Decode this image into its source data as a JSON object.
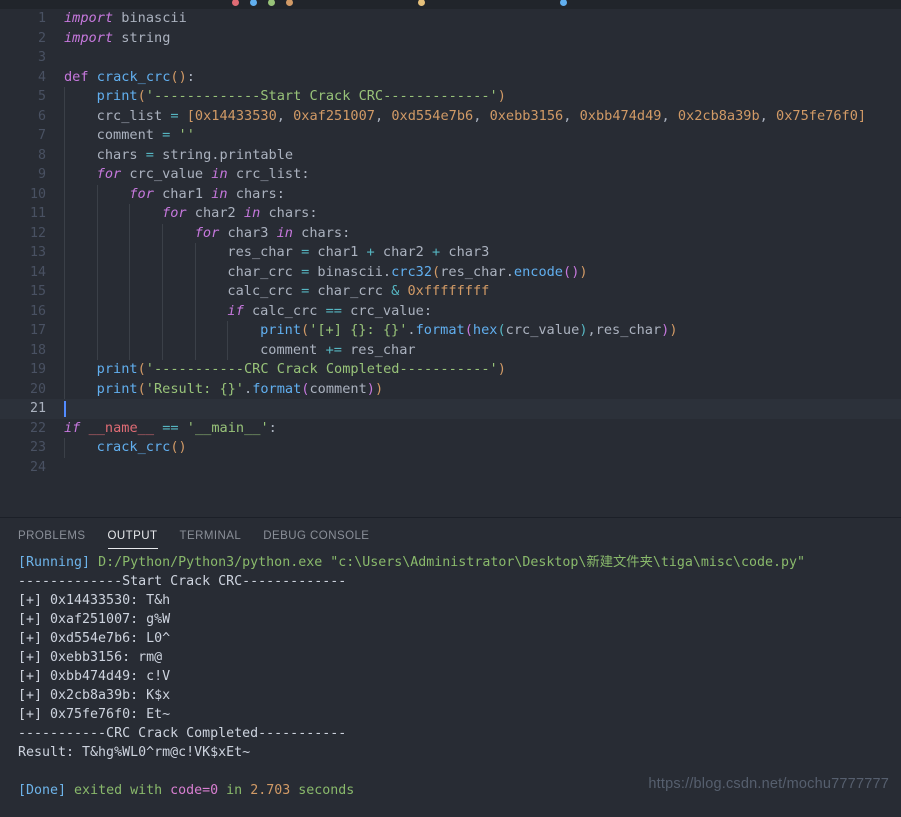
{
  "window": {
    "theme_name": "One Dark Pro",
    "editor_bg": "#282c34",
    "active_line_bg": "#2c313a",
    "panel_bg": "#282c34"
  },
  "editor": {
    "language": "python",
    "active_line": 21,
    "total_lines": 24,
    "lines": [
      {
        "n": "1",
        "indent": 0,
        "tokens": [
          {
            "t": "import",
            "c": "kw"
          },
          {
            "t": " binascii",
            "c": "plain"
          }
        ]
      },
      {
        "n": "2",
        "indent": 0,
        "tokens": [
          {
            "t": "import",
            "c": "kw"
          },
          {
            "t": " string",
            "c": "plain"
          }
        ]
      },
      {
        "n": "3",
        "indent": 0,
        "tokens": []
      },
      {
        "n": "4",
        "indent": 0,
        "tokens": [
          {
            "t": "def",
            "c": "kw2"
          },
          {
            "t": " ",
            "c": "plain"
          },
          {
            "t": "crack_crc",
            "c": "defn"
          },
          {
            "t": "()",
            "c": "par"
          },
          {
            "t": ":",
            "c": "punc"
          }
        ]
      },
      {
        "n": "5",
        "indent": 1,
        "tokens": [
          {
            "t": "print",
            "c": "fn"
          },
          {
            "t": "(",
            "c": "par"
          },
          {
            "t": "'-------------Start Crack CRC-------------'",
            "c": "str"
          },
          {
            "t": ")",
            "c": "par"
          }
        ]
      },
      {
        "n": "6",
        "indent": 1,
        "tokens": [
          {
            "t": "crc_list ",
            "c": "plain"
          },
          {
            "t": "=",
            "c": "op"
          },
          {
            "t": " ",
            "c": "plain"
          },
          {
            "t": "[",
            "c": "par"
          },
          {
            "t": "0x14433530",
            "c": "num"
          },
          {
            "t": ", ",
            "c": "plain"
          },
          {
            "t": "0xaf251007",
            "c": "num"
          },
          {
            "t": ", ",
            "c": "plain"
          },
          {
            "t": "0xd554e7b6",
            "c": "num"
          },
          {
            "t": ", ",
            "c": "plain"
          },
          {
            "t": "0xebb3156",
            "c": "num"
          },
          {
            "t": ", ",
            "c": "plain"
          },
          {
            "t": "0xbb474d49",
            "c": "num"
          },
          {
            "t": ", ",
            "c": "plain"
          },
          {
            "t": "0x2cb8a39b",
            "c": "num"
          },
          {
            "t": ", ",
            "c": "plain"
          },
          {
            "t": "0x75fe76f0",
            "c": "num"
          },
          {
            "t": "]",
            "c": "par"
          }
        ]
      },
      {
        "n": "7",
        "indent": 1,
        "tokens": [
          {
            "t": "comment ",
            "c": "plain"
          },
          {
            "t": "=",
            "c": "op"
          },
          {
            "t": " ",
            "c": "plain"
          },
          {
            "t": "''",
            "c": "str"
          }
        ]
      },
      {
        "n": "8",
        "indent": 1,
        "tokens": [
          {
            "t": "chars ",
            "c": "plain"
          },
          {
            "t": "=",
            "c": "op"
          },
          {
            "t": " string",
            "c": "plain"
          },
          {
            "t": ".",
            "c": "punc"
          },
          {
            "t": "printable",
            "c": "plain"
          }
        ]
      },
      {
        "n": "9",
        "indent": 1,
        "tokens": [
          {
            "t": "for",
            "c": "kw"
          },
          {
            "t": " crc_value ",
            "c": "plain"
          },
          {
            "t": "in",
            "c": "kw"
          },
          {
            "t": " crc_list",
            "c": "plain"
          },
          {
            "t": ":",
            "c": "punc"
          }
        ]
      },
      {
        "n": "10",
        "indent": 2,
        "tokens": [
          {
            "t": "for",
            "c": "kw"
          },
          {
            "t": " char1 ",
            "c": "plain"
          },
          {
            "t": "in",
            "c": "kw"
          },
          {
            "t": " chars",
            "c": "plain"
          },
          {
            "t": ":",
            "c": "punc"
          }
        ]
      },
      {
        "n": "11",
        "indent": 3,
        "tokens": [
          {
            "t": "for",
            "c": "kw"
          },
          {
            "t": " char2 ",
            "c": "plain"
          },
          {
            "t": "in",
            "c": "kw"
          },
          {
            "t": " chars",
            "c": "plain"
          },
          {
            "t": ":",
            "c": "punc"
          }
        ]
      },
      {
        "n": "12",
        "indent": 4,
        "tokens": [
          {
            "t": "for",
            "c": "kw"
          },
          {
            "t": " char3 ",
            "c": "plain"
          },
          {
            "t": "in",
            "c": "kw"
          },
          {
            "t": " chars",
            "c": "plain"
          },
          {
            "t": ":",
            "c": "punc"
          }
        ]
      },
      {
        "n": "13",
        "indent": 5,
        "tokens": [
          {
            "t": "res_char ",
            "c": "plain"
          },
          {
            "t": "=",
            "c": "op"
          },
          {
            "t": " char1 ",
            "c": "plain"
          },
          {
            "t": "+",
            "c": "op"
          },
          {
            "t": " char2 ",
            "c": "plain"
          },
          {
            "t": "+",
            "c": "op"
          },
          {
            "t": " char3",
            "c": "plain"
          }
        ]
      },
      {
        "n": "14",
        "indent": 5,
        "tokens": [
          {
            "t": "char_crc ",
            "c": "plain"
          },
          {
            "t": "=",
            "c": "op"
          },
          {
            "t": " binascii",
            "c": "plain"
          },
          {
            "t": ".",
            "c": "punc"
          },
          {
            "t": "crc32",
            "c": "fn"
          },
          {
            "t": "(",
            "c": "par"
          },
          {
            "t": "res_char",
            "c": "plain"
          },
          {
            "t": ".",
            "c": "punc"
          },
          {
            "t": "encode",
            "c": "fn"
          },
          {
            "t": "(",
            "c": "par2"
          },
          {
            "t": ")",
            "c": "par2"
          },
          {
            "t": ")",
            "c": "par"
          }
        ]
      },
      {
        "n": "15",
        "indent": 5,
        "tokens": [
          {
            "t": "calc_crc ",
            "c": "plain"
          },
          {
            "t": "=",
            "c": "op"
          },
          {
            "t": " char_crc ",
            "c": "plain"
          },
          {
            "t": "&",
            "c": "op"
          },
          {
            "t": " ",
            "c": "plain"
          },
          {
            "t": "0xffffffff",
            "c": "num"
          }
        ]
      },
      {
        "n": "16",
        "indent": 5,
        "tokens": [
          {
            "t": "if",
            "c": "kw"
          },
          {
            "t": " calc_crc ",
            "c": "plain"
          },
          {
            "t": "==",
            "c": "op"
          },
          {
            "t": " crc_value",
            "c": "plain"
          },
          {
            "t": ":",
            "c": "punc"
          }
        ]
      },
      {
        "n": "17",
        "indent": 6,
        "tokens": [
          {
            "t": "print",
            "c": "fn"
          },
          {
            "t": "(",
            "c": "par"
          },
          {
            "t": "'[+] {}: {}'",
            "c": "str"
          },
          {
            "t": ".",
            "c": "punc"
          },
          {
            "t": "format",
            "c": "fn"
          },
          {
            "t": "(",
            "c": "par2"
          },
          {
            "t": "hex",
            "c": "fn"
          },
          {
            "t": "(",
            "c": "par3"
          },
          {
            "t": "crc_value",
            "c": "plain"
          },
          {
            "t": ")",
            "c": "par3"
          },
          {
            "t": ",res_char",
            "c": "plain"
          },
          {
            "t": ")",
            "c": "par2"
          },
          {
            "t": ")",
            "c": "par"
          }
        ]
      },
      {
        "n": "18",
        "indent": 6,
        "tokens": [
          {
            "t": "comment ",
            "c": "plain"
          },
          {
            "t": "+=",
            "c": "op"
          },
          {
            "t": " res_char",
            "c": "plain"
          }
        ]
      },
      {
        "n": "19",
        "indent": 1,
        "tokens": [
          {
            "t": "print",
            "c": "fn"
          },
          {
            "t": "(",
            "c": "par"
          },
          {
            "t": "'-----------CRC Crack Completed-----------'",
            "c": "str"
          },
          {
            "t": ")",
            "c": "par"
          }
        ]
      },
      {
        "n": "20",
        "indent": 1,
        "tokens": [
          {
            "t": "print",
            "c": "fn"
          },
          {
            "t": "(",
            "c": "par"
          },
          {
            "t": "'Result: {}'",
            "c": "str"
          },
          {
            "t": ".",
            "c": "punc"
          },
          {
            "t": "format",
            "c": "fn"
          },
          {
            "t": "(",
            "c": "par2"
          },
          {
            "t": "comment",
            "c": "plain"
          },
          {
            "t": ")",
            "c": "par2"
          },
          {
            "t": ")",
            "c": "par"
          }
        ]
      },
      {
        "n": "21",
        "indent": 0,
        "tokens": []
      },
      {
        "n": "22",
        "indent": 0,
        "tokens": [
          {
            "t": "if",
            "c": "kw"
          },
          {
            "t": " ",
            "c": "plain"
          },
          {
            "t": "__name__",
            "c": "var"
          },
          {
            "t": " ",
            "c": "plain"
          },
          {
            "t": "==",
            "c": "op"
          },
          {
            "t": " ",
            "c": "plain"
          },
          {
            "t": "'__main__'",
            "c": "str"
          },
          {
            "t": ":",
            "c": "punc"
          }
        ]
      },
      {
        "n": "23",
        "indent": 1,
        "tokens": [
          {
            "t": "crack_crc",
            "c": "fn"
          },
          {
            "t": "()",
            "c": "par"
          }
        ]
      },
      {
        "n": "24",
        "indent": 0,
        "tokens": []
      }
    ]
  },
  "panel": {
    "tabs": [
      {
        "label": "PROBLEMS",
        "active": false
      },
      {
        "label": "OUTPUT",
        "active": true
      },
      {
        "label": "TERMINAL",
        "active": false
      },
      {
        "label": "DEBUG CONSOLE",
        "active": false
      }
    ],
    "output_lines": [
      {
        "segments": [
          {
            "t": "[Running]",
            "c": "o-run"
          },
          {
            "t": " D:/Python/Python3/python.exe \"c:\\Users\\Administrator\\Desktop\\新建文件夹\\tiga\\misc\\code.py\"",
            "c": "o-path"
          }
        ]
      },
      {
        "segments": [
          {
            "t": "-------------Start Crack CRC-------------",
            "c": "o-grey"
          }
        ]
      },
      {
        "segments": [
          {
            "t": "[+] 0x14433530: T&h",
            "c": "o-grey"
          }
        ]
      },
      {
        "segments": [
          {
            "t": "[+] 0xaf251007: g%W",
            "c": "o-grey"
          }
        ]
      },
      {
        "segments": [
          {
            "t": "[+] 0xd554e7b6: L0^",
            "c": "o-grey"
          }
        ]
      },
      {
        "segments": [
          {
            "t": "[+] 0xebb3156: rm@",
            "c": "o-grey"
          }
        ]
      },
      {
        "segments": [
          {
            "t": "[+] 0xbb474d49: c!V",
            "c": "o-grey"
          }
        ]
      },
      {
        "segments": [
          {
            "t": "[+] 0x2cb8a39b: K$x",
            "c": "o-grey"
          }
        ]
      },
      {
        "segments": [
          {
            "t": "[+] 0x75fe76f0: Et~",
            "c": "o-grey"
          }
        ]
      },
      {
        "segments": [
          {
            "t": "-----------CRC Crack Completed-----------",
            "c": "o-grey"
          }
        ]
      },
      {
        "segments": [
          {
            "t": "Result: T&hg%WL0^rm@c!VK$xEt~",
            "c": "o-grey"
          }
        ]
      },
      {
        "segments": [
          {
            "t": "",
            "c": "o-grey"
          }
        ]
      },
      {
        "segments": [
          {
            "t": "[Done]",
            "c": "o-done"
          },
          {
            "t": " exited with ",
            "c": "o-green"
          },
          {
            "t": "code=0",
            "c": "o-pink"
          },
          {
            "t": " in ",
            "c": "o-green"
          },
          {
            "t": "2.703",
            "c": "o-num"
          },
          {
            "t": " seconds",
            "c": "o-green"
          }
        ]
      }
    ]
  },
  "watermark": {
    "text": "https://blog.csdn.net/mochu7777777"
  }
}
